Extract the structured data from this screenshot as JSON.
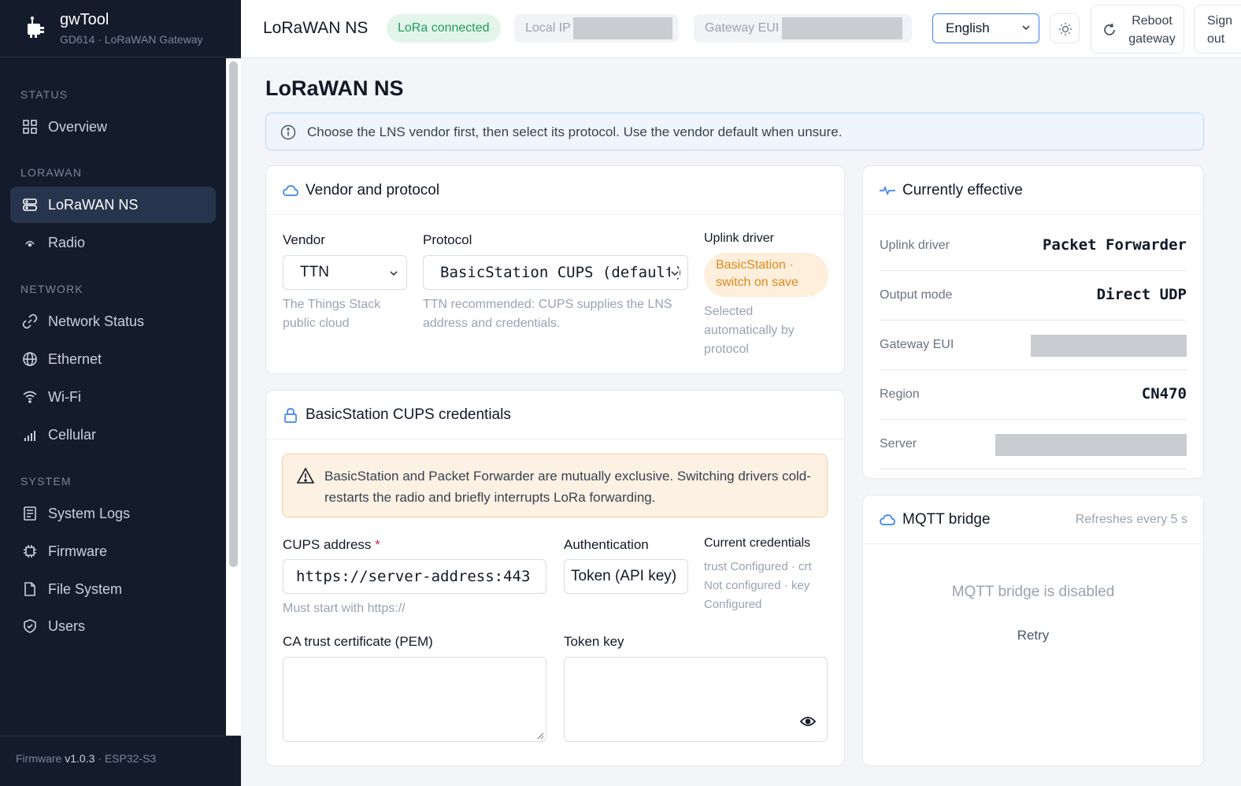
{
  "app": {
    "name": "gwTool",
    "subtitle": "GD614 · LoRaWAN Gateway"
  },
  "sidebar": {
    "sections": [
      {
        "title": "STATUS",
        "items": [
          {
            "label": "Overview",
            "icon": "grid-icon"
          }
        ]
      },
      {
        "title": "LORAWAN",
        "items": [
          {
            "label": "LoRaWAN NS",
            "icon": "server-icon",
            "active": true
          },
          {
            "label": "Radio",
            "icon": "radio-icon"
          }
        ]
      },
      {
        "title": "NETWORK",
        "items": [
          {
            "label": "Network Status",
            "icon": "link-icon"
          },
          {
            "label": "Ethernet",
            "icon": "globe-icon"
          },
          {
            "label": "Wi-Fi",
            "icon": "wifi-icon"
          },
          {
            "label": "Cellular",
            "icon": "signal-icon"
          }
        ]
      },
      {
        "title": "SYSTEM",
        "items": [
          {
            "label": "System Logs",
            "icon": "logs-icon"
          },
          {
            "label": "Firmware",
            "icon": "chip-icon"
          },
          {
            "label": "File System",
            "icon": "file-icon"
          },
          {
            "label": "Users",
            "icon": "shield-icon"
          }
        ]
      }
    ],
    "footer": {
      "prefix": "Firmware",
      "version": "v1.0.3",
      "chip": "· ESP32-S3"
    }
  },
  "topbar": {
    "title": "LoRaWAN NS",
    "lora_status": "LoRa connected",
    "local_ip_label": "Local IP",
    "gateway_eui_label": "Gateway EUI",
    "language": "English",
    "reboot_label_1": "Reboot",
    "reboot_label_2": "gateway",
    "signout_label_1": "Sign",
    "signout_label_2": "out"
  },
  "main": {
    "title": "LoRaWAN NS",
    "info": "Choose the LNS vendor first, then select its protocol. Use the vendor default when unsure."
  },
  "vendor_card": {
    "title": "Vendor and protocol",
    "vendor_label": "Vendor",
    "vendor_value": "TTN",
    "vendor_help": "The Things Stack public cloud",
    "protocol_label": "Protocol",
    "protocol_value": "BasicStation CUPS (default)",
    "protocol_help": "TTN recommended: CUPS supplies the LNS address and credentials.",
    "uplink_label": "Uplink driver",
    "uplink_pill": "BasicStation · switch on save",
    "uplink_help": "Selected automatically by protocol"
  },
  "cups_card": {
    "title": "BasicStation CUPS credentials",
    "warning": "BasicStation and Packet Forwarder are mutually exclusive. Switching drivers cold-restarts the radio and briefly interrupts LoRa forwarding.",
    "address_label": "CUPS address",
    "address_required": "*",
    "address_value": "https://server-address:443",
    "address_help": "Must start with https://",
    "auth_label": "Authentication",
    "auth_value": "Token (API key)",
    "cred_label": "Current credentials",
    "cred_text": "trust Configured · crt Not configured · key Configured",
    "ca_label": "CA trust certificate (PEM)",
    "token_label": "Token key"
  },
  "effective_card": {
    "title": "Currently effective",
    "rows": [
      {
        "key": "Uplink driver",
        "value": "Packet Forwarder"
      },
      {
        "key": "Output mode",
        "value": "Direct UDP"
      },
      {
        "key": "Gateway EUI",
        "value": ""
      },
      {
        "key": "Region",
        "value": "CN470"
      },
      {
        "key": "Server",
        "value": ""
      }
    ]
  },
  "mqtt_card": {
    "title": "MQTT bridge",
    "refresh": "Refreshes every 5 s",
    "empty": "MQTT bridge is disabled",
    "retry": "Retry"
  },
  "colors": {
    "sidebar_bg": "#141c2b",
    "active_item": "#26344d",
    "accent": "#3b82f6",
    "success": "#1e9e5a",
    "warning": "#dd8a1f"
  }
}
